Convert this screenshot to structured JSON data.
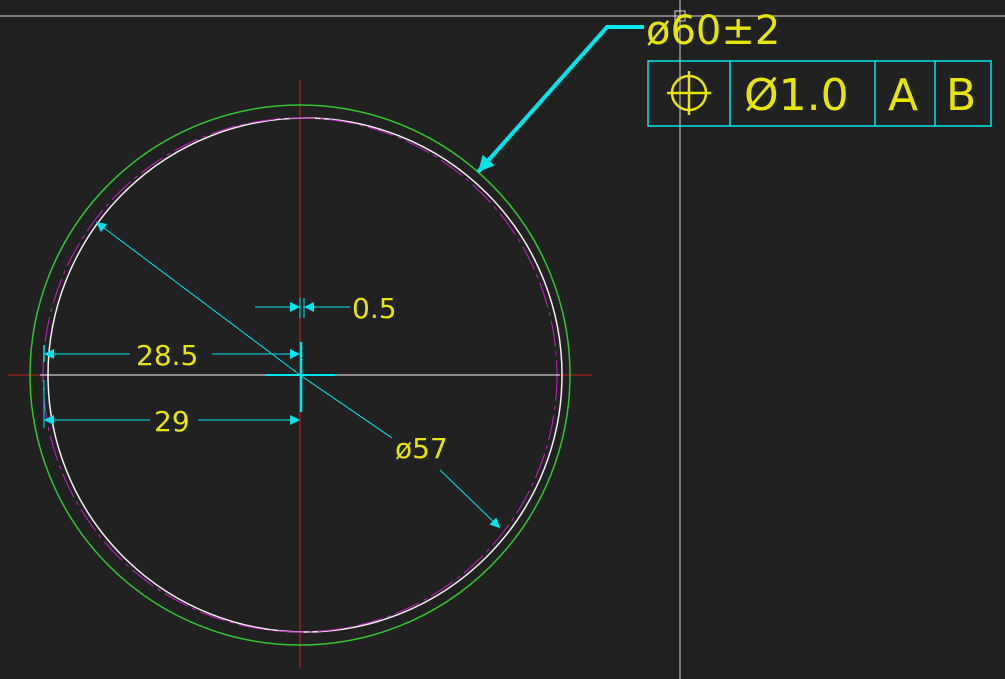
{
  "drawing": {
    "outer_diameter_label": "ø60±2",
    "inner_diameter_label": "ø57",
    "offset_label": "0.5",
    "radius_inner_label": "28.5",
    "radius_outer_label": "29"
  },
  "feature_control_frame": {
    "symbol": "position-icon",
    "tolerance": "Ø1.0",
    "datum_primary": "A",
    "datum_secondary": "B"
  },
  "colors": {
    "background": "#212121",
    "dimension": "#00e5ee",
    "text": "#e6e600",
    "centerline": "#d11a1a",
    "outer_circle": "#2ec72e",
    "inner_circle": "#c81fc8",
    "part_circle": "#f2f2f2",
    "crosshair": "#d8d8d8"
  }
}
